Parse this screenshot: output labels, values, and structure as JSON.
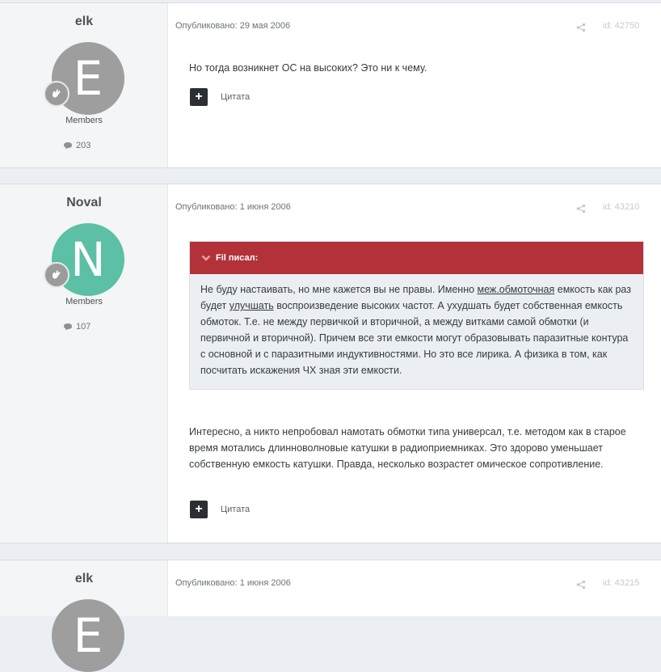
{
  "posts": [
    {
      "author": "elk",
      "avatar_letter": "E",
      "avatar_color": "#9e9e9e",
      "group": "Members",
      "post_count": "203",
      "published": "Опубликовано: 29 мая 2006",
      "post_id": "id: 42750",
      "text": "Но тогда возникнет ОС на высоких? Это ни к чему.",
      "quote_label": "Цитата"
    },
    {
      "author": "Noval",
      "avatar_letter": "N",
      "avatar_color": "#5bc0a5",
      "group": "Members",
      "post_count": "107",
      "published": "Опубликовано: 1 июня 2006",
      "post_id": "id: 43210",
      "quote": {
        "citation": "Fil писал:",
        "part1": "Не буду настаивать, но мне кажется вы не правы. Именно ",
        "link1": "меж.обмоточная",
        "part2": " емкость как раз будет ",
        "link2": "улучшать",
        "part3": " воспроизведение высоких частот. А ухудшать будет собственная емкость обмоток. Т.е. не между первичкой и вторичной, а между витками самой обмотки (и первичной и вторичной). Причем все эти емкости могут образовывать паразитные контура с основной и с паразитными индуктивностями. Но это все лирика. А физика в том, как посчитать искажения ЧХ зная эти емкости."
      },
      "text": "Интересно, а никто непробовал намотать обмотки типа универсал, т.е. методом как в старое время мотались длинноволновые катушки в радиоприемниках. Это здорово уменьшает собственную емкость катушки. Правда, несколько возрастет омическое сопротивление.",
      "quote_label": "Цитата"
    },
    {
      "author": "elk",
      "avatar_letter": "E",
      "avatar_color": "#9e9e9e",
      "published": "Опубликовано: 1 июня 2006",
      "post_id": "id: 43215"
    }
  ]
}
